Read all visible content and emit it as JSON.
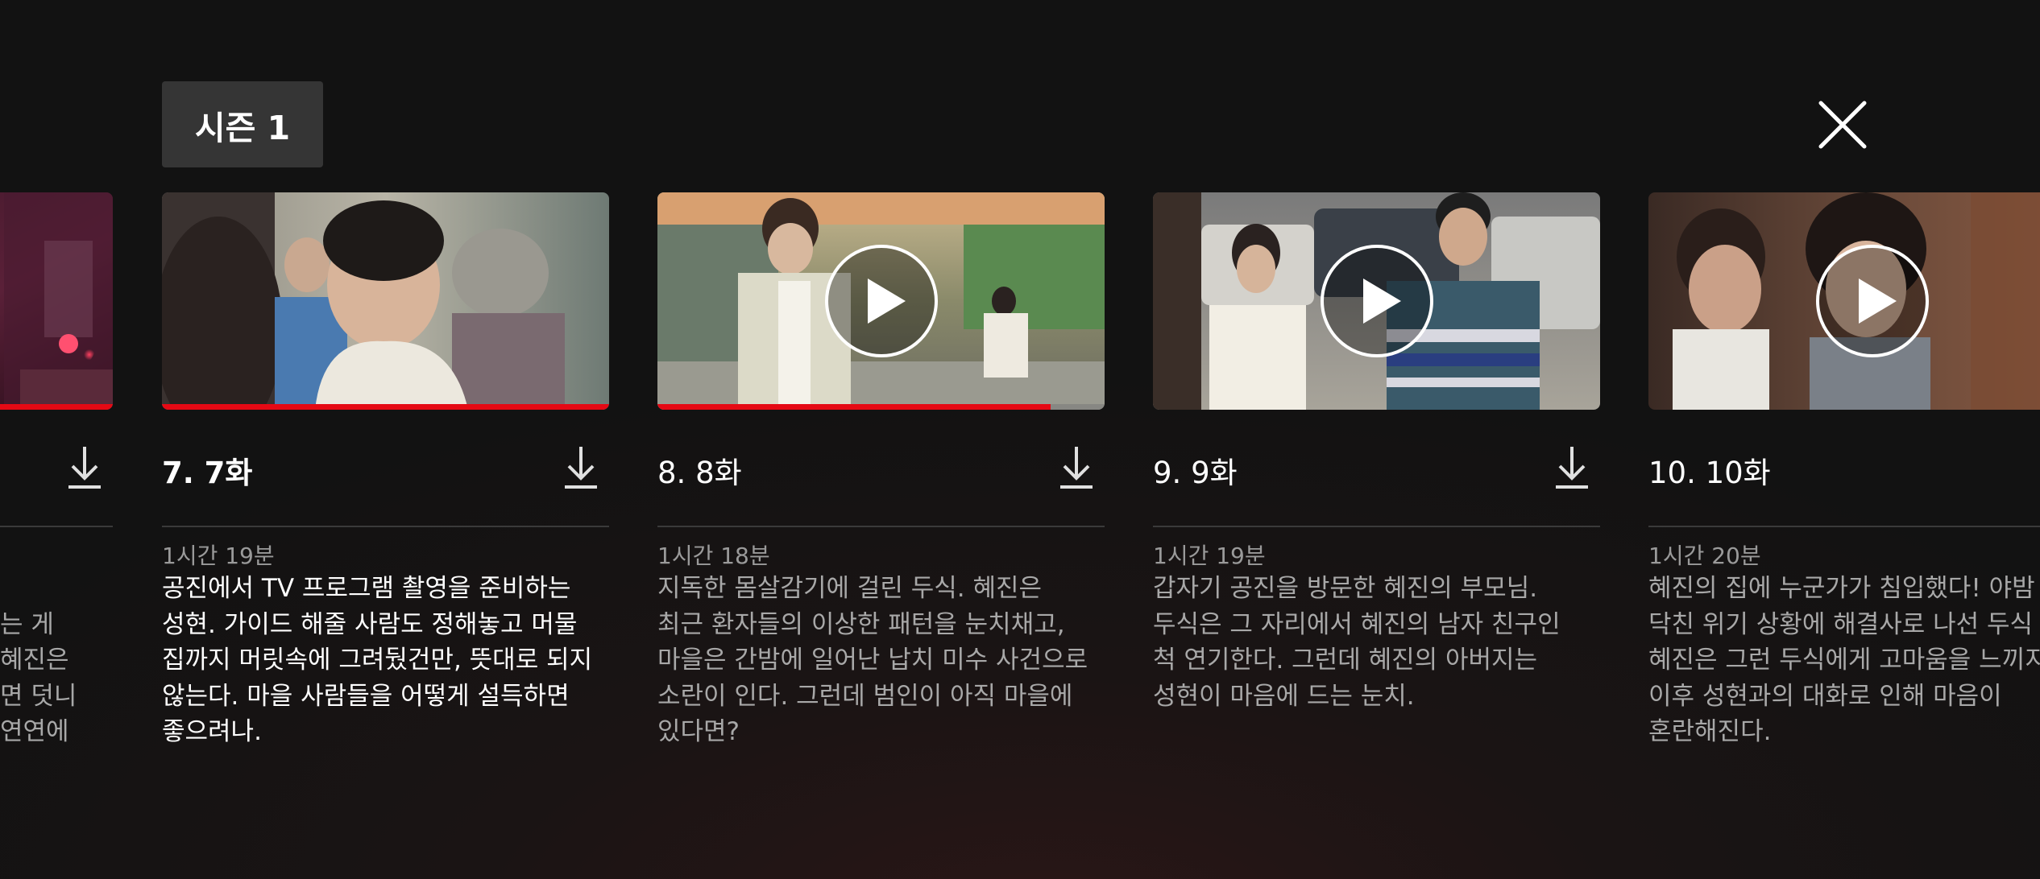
{
  "season_selector": {
    "label": "시즌 1"
  },
  "close_button": {
    "icon": "close-icon"
  },
  "colors": {
    "accent": "#e50914",
    "background": "#141414",
    "text_dim": "#a8a8a8"
  },
  "episodes": [
    {
      "title": "",
      "duration": "",
      "synopsis": "는 게\n혜진은\n면 덧니\n연연에",
      "progress": 1.0,
      "has_play_icon": false
    },
    {
      "title": "7. 7화",
      "duration": "1시간 19분",
      "synopsis": "공진에서 TV 프로그램 촬영을 준비하는\n성현. 가이드 해줄 사람도 정해놓고 머물\n집까지 머릿속에 그려뒀건만, 뜻대로 되지\n않는다. 마을 사람들을 어떻게 설득하면\n좋으려나.",
      "progress": 1.0,
      "has_play_icon": false,
      "current": true
    },
    {
      "title": "8. 8화",
      "duration": "1시간 18분",
      "synopsis": "지독한 몸살감기에 걸린 두식. 혜진은\n최근 환자들의 이상한 패턴을 눈치채고,\n마을은 간밤에 일어난 납치 미수 사건으로\n소란이 인다. 그런데 범인이 아직 마을에\n있다면?",
      "progress": 0.88,
      "has_play_icon": true
    },
    {
      "title": "9. 9화",
      "duration": "1시간 19분",
      "synopsis": "갑자기 공진을 방문한 혜진의 부모님.\n두식은 그 자리에서 혜진의 남자 친구인\n척 연기한다. 그런데 혜진의 아버지는\n성현이 마음에 드는 눈치.",
      "progress": 0,
      "has_play_icon": true
    },
    {
      "title": "10. 10화",
      "duration": "1시간 20분",
      "synopsis": "혜진의 집에 누군가가 침입했다! 야밤\n닥친 위기 상황에 해결사로 나선 두식\n혜진은 그런 두식에게 고마움을 느끼지\n이후 성현과의 대화로 인해 마음이\n혼란해진다.",
      "progress": 0,
      "has_play_icon": true
    }
  ]
}
